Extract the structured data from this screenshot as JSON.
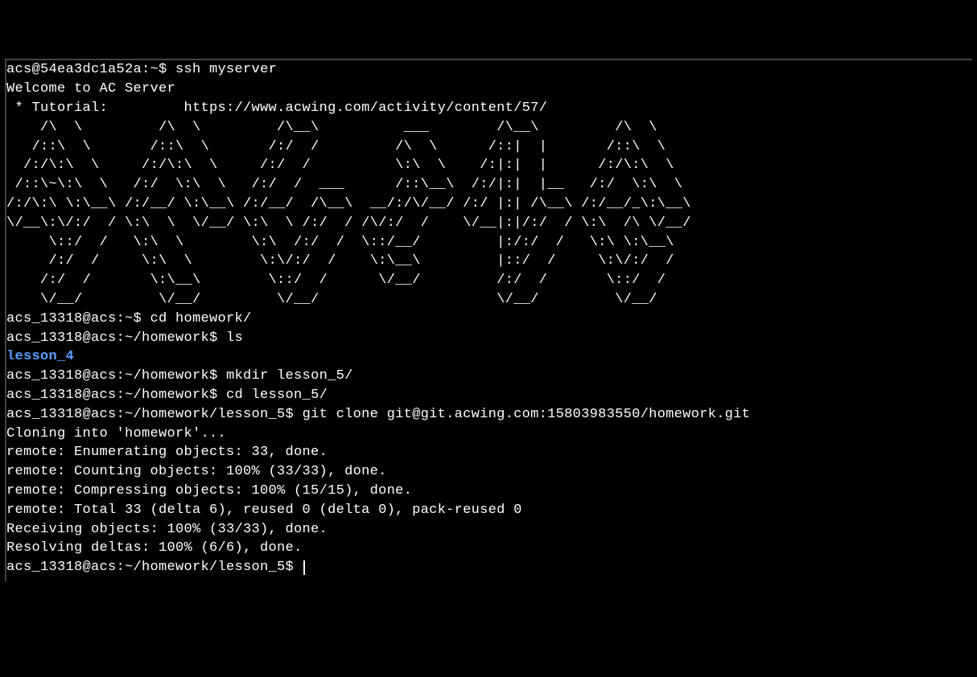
{
  "lines": [
    {
      "prompt": "acs@54ea3dc1a52a:~$ ",
      "cmd": "ssh myserver"
    },
    {
      "text": "Welcome to AC Server"
    },
    {
      "text": " * Tutorial:         https://www.acwing.com/activity/content/57/"
    },
    {
      "text": ""
    },
    {
      "text": "    /\\  \\         /\\  \\         /\\__\\          ___        /\\__\\         /\\  \\"
    },
    {
      "text": "   /::\\  \\       /::\\  \\       /:/  /         /\\  \\      /::|  |       /::\\  \\"
    },
    {
      "text": "  /:/\\:\\  \\     /:/\\:\\  \\     /:/  /          \\:\\  \\    /:|:|  |      /:/\\:\\  \\"
    },
    {
      "text": " /::\\~\\:\\  \\   /:/  \\:\\  \\   /:/  /  ___      /::\\__\\  /:/|:|  |__   /:/  \\:\\  \\"
    },
    {
      "text": "/:/\\:\\ \\:\\__\\ /:/__/ \\:\\__\\ /:/__/  /\\__\\  __/:/\\/__/ /:/ |:| /\\__\\ /:/__/_\\:\\__\\"
    },
    {
      "text": "\\/__\\:\\/:/  / \\:\\  \\  \\/__/ \\:\\  \\ /:/  / /\\/:/  /    \\/__|:|/:/  / \\:\\  /\\ \\/__/"
    },
    {
      "text": "     \\::/  /   \\:\\  \\        \\:\\  /:/  /  \\::/__/         |:/:/  /   \\:\\ \\:\\__\\"
    },
    {
      "text": "     /:/  /     \\:\\  \\        \\:\\/:/  /    \\:\\__\\         |::/  /     \\:\\/:/  /"
    },
    {
      "text": "    /:/  /       \\:\\__\\        \\::/  /      \\/__/         /:/  /       \\::/  /"
    },
    {
      "text": "    \\/__/         \\/__/         \\/__/                     \\/__/         \\/__/"
    },
    {
      "text": ""
    },
    {
      "prompt": "acs_13318@acs:~$ ",
      "cmd": "cd homework/"
    },
    {
      "prompt": "acs_13318@acs:~/homework$ ",
      "cmd": "ls"
    },
    {
      "dir": "lesson_4"
    },
    {
      "prompt": "acs_13318@acs:~/homework$ ",
      "cmd": "mkdir lesson_5/"
    },
    {
      "prompt": "acs_13318@acs:~/homework$ ",
      "cmd": "cd lesson_5/"
    },
    {
      "prompt": "acs_13318@acs:~/homework/lesson_5$ ",
      "cmd": "git clone git@git.acwing.com:15803983550/homework.git"
    },
    {
      "text": "Cloning into 'homework'..."
    },
    {
      "text": "remote: Enumerating objects: 33, done."
    },
    {
      "text": "remote: Counting objects: 100% (33/33), done."
    },
    {
      "text": "remote: Compressing objects: 100% (15/15), done."
    },
    {
      "text": "remote: Total 33 (delta 6), reused 0 (delta 0), pack-reused 0"
    },
    {
      "text": "Receiving objects: 100% (33/33), done."
    },
    {
      "text": "Resolving deltas: 100% (6/6), done."
    },
    {
      "prompt": "acs_13318@acs:~/homework/lesson_5$ ",
      "cmd": "",
      "cursor": true
    }
  ]
}
